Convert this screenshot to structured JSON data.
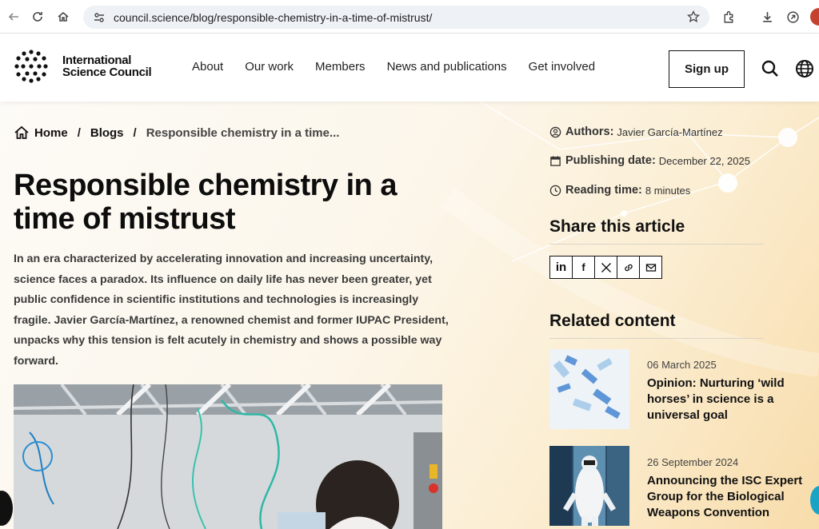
{
  "browser": {
    "url": "council.science/blog/responsible-chemistry-in-a-time-of-mistrust/"
  },
  "header": {
    "logo_line1": "International",
    "logo_line2": "Science Council",
    "nav": [
      "About",
      "Our work",
      "Members",
      "News and publications",
      "Get involved"
    ],
    "signup_label": "Sign up"
  },
  "breadcrumb": {
    "home": "Home",
    "sep": "/",
    "blogs": "Blogs",
    "current": "Responsible chemistry in a time..."
  },
  "article": {
    "title": "Responsible chemistry in a time of mistrust",
    "lead": "In an era characterized by accelerating innovation and increasing uncertainty, science faces a paradox. Its influence on daily life has never been greater, yet public confidence in scientific institutions and technologies is increasingly fragile. Javier García-Martínez, a renowned chemist and former IUPAC President, unpacks why this tension is felt acutely in chemistry and shows a possible way forward."
  },
  "meta": {
    "authors_label": "Authors:",
    "authors_value": "Javier García-Martínez",
    "date_label": "Publishing date:",
    "date_value": "December 22, 2025",
    "reading_label": "Reading time:",
    "reading_value": "8 minutes"
  },
  "share": {
    "heading": "Share this article",
    "linkedin": "in",
    "facebook": "f"
  },
  "related": {
    "heading": "Related content",
    "items": [
      {
        "date": "06 March 2025",
        "title": "Opinion: Nurturing ‘wild horses’ in science is a universal goal"
      },
      {
        "date": "26 September 2024",
        "title": "Announcing the ISC Expert Group for the Biological Weapons Convention"
      }
    ]
  },
  "colors": {
    "accent": "#19a3c4",
    "background_warm": "#f8dcaa",
    "text": "#111111"
  }
}
